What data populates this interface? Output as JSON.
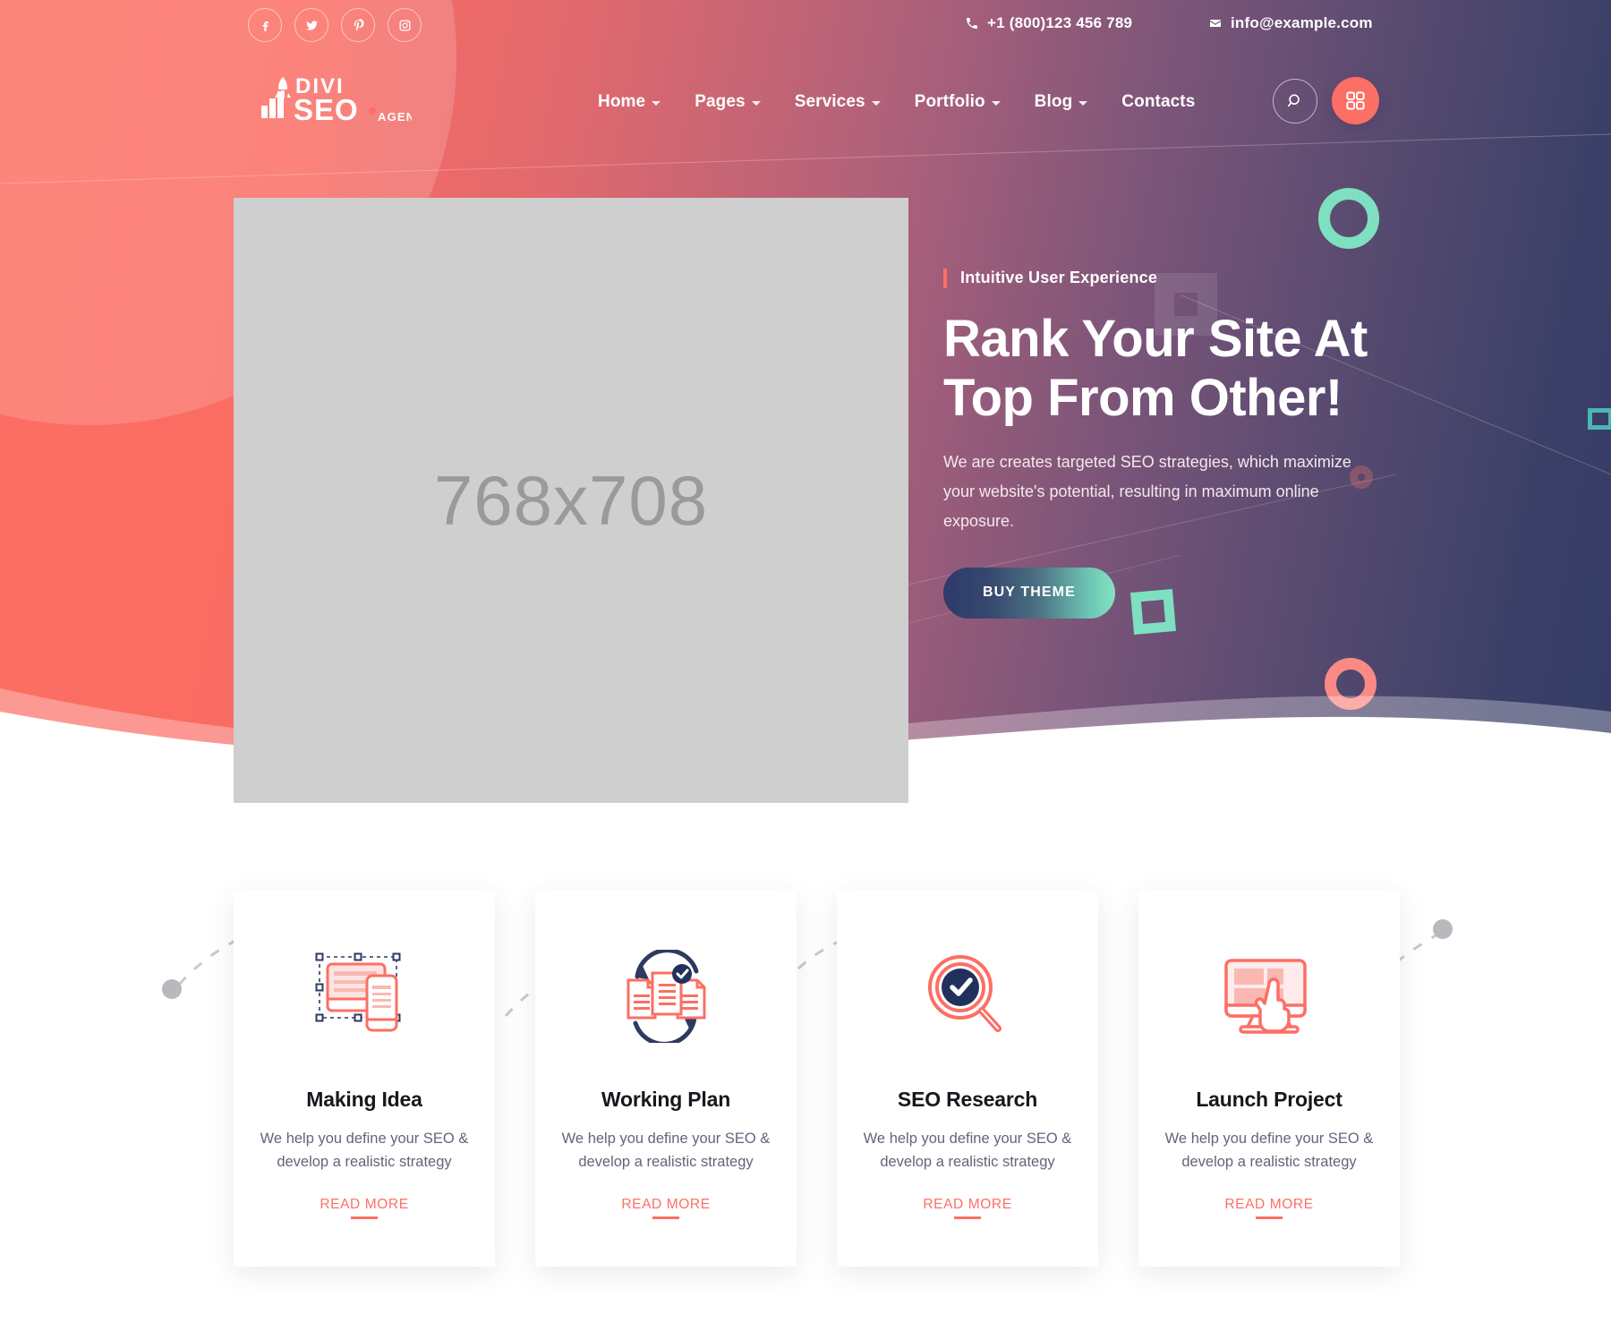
{
  "theme": {
    "coral": "#fc6f64",
    "mint": "#7ee0c0",
    "navy": "#2e3a6b",
    "teal": "#4bb6b0",
    "text_dark": "#17181d",
    "text_muted": "#63647a"
  },
  "topbar": {
    "social": [
      {
        "name": "facebook-icon",
        "label": "Facebook"
      },
      {
        "name": "twitter-icon",
        "label": "Twitter"
      },
      {
        "name": "pinterest-icon",
        "label": "Pinterest"
      },
      {
        "name": "instagram-icon",
        "label": "Instagram"
      }
    ],
    "phone": "+1 (800)123 456 789",
    "email": "info@example.com"
  },
  "brand": {
    "line1": "DIVI",
    "line2": "SEO",
    "suffix": "AGENCY"
  },
  "nav": {
    "items": [
      {
        "label": "Home",
        "has_dropdown": true
      },
      {
        "label": "Pages",
        "has_dropdown": true
      },
      {
        "label": "Services",
        "has_dropdown": true
      },
      {
        "label": "Portfolio",
        "has_dropdown": true
      },
      {
        "label": "Blog",
        "has_dropdown": true
      },
      {
        "label": "Contacts",
        "has_dropdown": false
      }
    ],
    "search_icon": "search-icon",
    "grid_icon": "grid-menu-icon"
  },
  "hero": {
    "image_placeholder": "768x708",
    "eyebrow": "Intuitive User Experience",
    "title_line1": "Rank Your Site At",
    "title_line2": "Top From Other!",
    "description": "We are creates targeted SEO strategies, which maximize your website's potential, resulting in maximum online exposure.",
    "cta_label": "BUY THEME"
  },
  "features": {
    "cards": [
      {
        "icon": "devices-design-icon",
        "title": "Making Idea",
        "description": "We help you define your SEO & develop a realistic strategy",
        "link_label": "READ MORE"
      },
      {
        "icon": "documents-cycle-icon",
        "title": "Working Plan",
        "description": "We help you define your SEO & develop a realistic strategy",
        "link_label": "READ MORE"
      },
      {
        "icon": "magnifier-check-icon",
        "title": "SEO Research",
        "description": "We help you define your SEO & develop a realistic strategy",
        "link_label": "READ MORE"
      },
      {
        "icon": "monitor-click-icon",
        "title": "Launch Project",
        "description": "We help you define your SEO & develop a realistic strategy",
        "link_label": "READ MORE"
      }
    ]
  }
}
